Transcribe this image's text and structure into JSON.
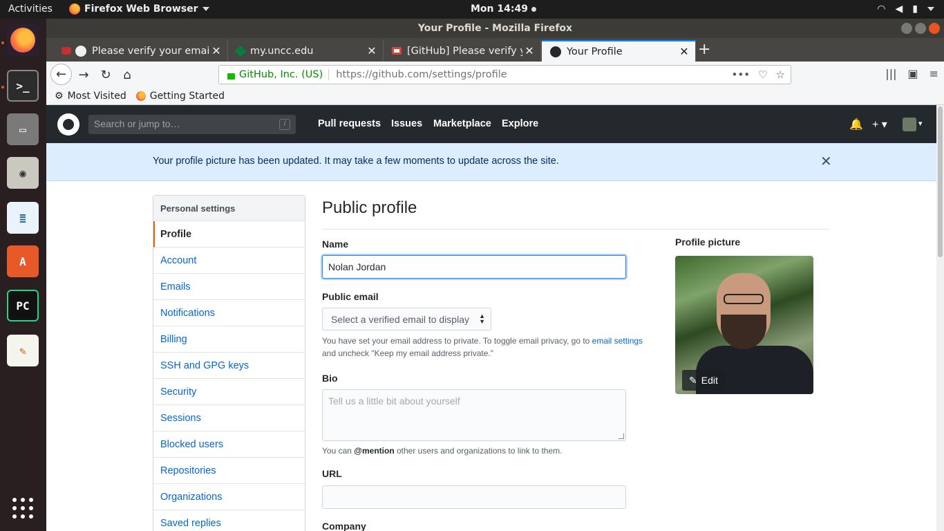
{
  "topbar": {
    "activities": "Activities",
    "app_name": "Firefox Web Browser",
    "clock": "Mon 14:49"
  },
  "window": {
    "title": "Your Profile - Mozilla Firefox"
  },
  "tabs": [
    {
      "title": "Please verify your email a"
    },
    {
      "title": "my.uncc.edu"
    },
    {
      "title": "[GitHub] Please verify yo"
    },
    {
      "title": "Your Profile",
      "active": true
    }
  ],
  "urlbar": {
    "identity": "GitHub, Inc. (US)",
    "url": "https://github.com/settings/profile"
  },
  "bookmarks": [
    {
      "label": "Most Visited",
      "icon": "gear-icon"
    },
    {
      "label": "Getting Started",
      "icon": "firefox-icon"
    }
  ],
  "github": {
    "search_placeholder": "Search or jump to…",
    "search_shortcut": "/",
    "nav": [
      "Pull requests",
      "Issues",
      "Marketplace",
      "Explore"
    ],
    "flash_message": "Your profile picture has been updated. It may take a few moments to update across the site.",
    "flash_close": "✕",
    "header_color": "#24292e",
    "link_color": "#0366d6"
  },
  "side_menu": {
    "header": "Personal settings",
    "items": [
      "Profile",
      "Account",
      "Emails",
      "Notifications",
      "Billing",
      "SSH and GPG keys",
      "Security",
      "Sessions",
      "Blocked users",
      "Repositories",
      "Organizations",
      "Saved replies"
    ],
    "selected": "Profile"
  },
  "profile_form": {
    "title": "Public profile",
    "name_label": "Name",
    "name_value": "Nolan Jordan",
    "email_label": "Public email",
    "email_select": "Select a verified email to display",
    "email_note_1": "You have set your email address to private. To toggle email privacy, go to",
    "email_note_link": "email settings",
    "email_note_2": "and uncheck \"Keep my email address private.\"",
    "bio_label": "Bio",
    "bio_placeholder": "Tell us a little bit about yourself",
    "bio_note_1": "You can",
    "bio_note_mention": "@mention",
    "bio_note_2": "other users and organizations to link to them.",
    "url_label": "URL",
    "url_value": "",
    "company_label": "Company",
    "picture_label": "Profile picture",
    "edit_label": "Edit"
  }
}
